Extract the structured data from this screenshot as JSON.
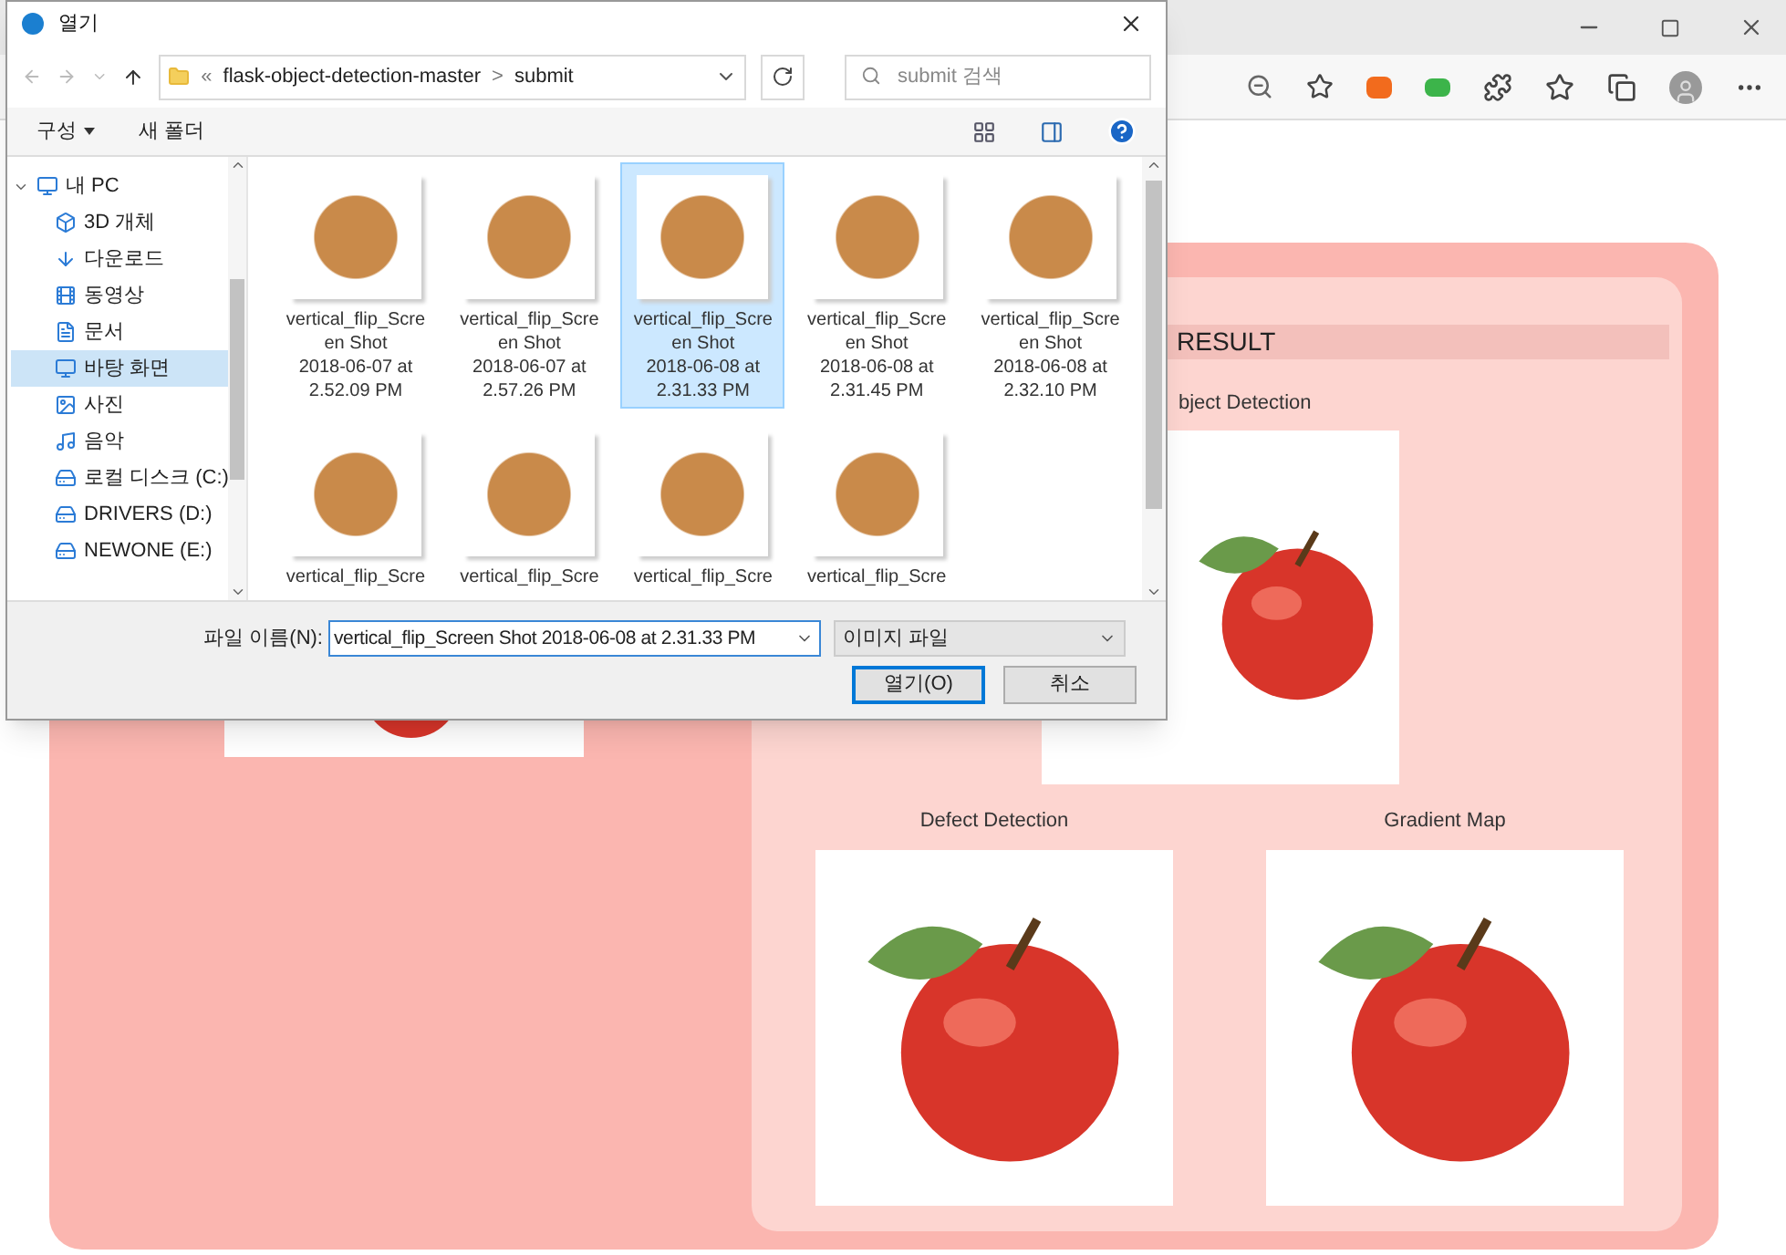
{
  "page": {
    "result_title": "RESULT",
    "panels": [
      {
        "title": "bject Detection"
      },
      {
        "title": "Defect Detection"
      },
      {
        "title": "Gradient Map"
      }
    ]
  },
  "dialog": {
    "title": "열기",
    "address": {
      "prefix": "«",
      "folder": "flask-object-detection-master",
      "separator": ">",
      "current": "submit"
    },
    "search": {
      "placeholder": "submit 검색"
    },
    "toolbar": [
      {
        "label": "구성",
        "kind": "menu"
      },
      {
        "label": "새 폴더",
        "kind": "button"
      }
    ],
    "sidebar": [
      {
        "label": "내 PC",
        "kind": "pc",
        "expanded": true,
        "selected": false,
        "children": [
          {
            "label": "3D 개체",
            "kind": "cube",
            "selected": false
          },
          {
            "label": "다운로드",
            "kind": "download",
            "selected": false
          },
          {
            "label": "동영상",
            "kind": "video",
            "selected": false
          },
          {
            "label": "문서",
            "kind": "document",
            "selected": false
          },
          {
            "label": "바탕 화면",
            "kind": "desktop",
            "selected": true
          },
          {
            "label": "사진",
            "kind": "picture",
            "selected": false
          },
          {
            "label": "음악",
            "kind": "music",
            "selected": false
          },
          {
            "label": "로컬 디스크 (C:)",
            "kind": "disk",
            "selected": false
          },
          {
            "label": "DRIVERS (D:)",
            "kind": "drive",
            "selected": false
          },
          {
            "label": "NEWONE (E:)",
            "kind": "drive",
            "selected": false
          }
        ]
      }
    ],
    "files": [
      {
        "lines": [
          "vertical_flip_Scre",
          "en Shot",
          "2018-06-07 at",
          "2.52.09 PM"
        ],
        "selected": false
      },
      {
        "lines": [
          "vertical_flip_Scre",
          "en Shot",
          "2018-06-07 at",
          "2.57.26 PM"
        ],
        "selected": false
      },
      {
        "lines": [
          "vertical_flip_Scre",
          "en Shot",
          "2018-06-08 at",
          "2.31.33 PM"
        ],
        "selected": true
      },
      {
        "lines": [
          "vertical_flip_Scre",
          "en Shot",
          "2018-06-08 at",
          "2.31.45 PM"
        ],
        "selected": false
      },
      {
        "lines": [
          "vertical_flip_Scre",
          "en Shot",
          "2018-06-08 at",
          "2.32.10 PM"
        ],
        "selected": false
      },
      {
        "lines": [
          "vertical_flip_Scre"
        ],
        "selected": false
      },
      {
        "lines": [
          "vertical_flip_Scre"
        ],
        "selected": false
      },
      {
        "lines": [
          "vertical_flip_Scre"
        ],
        "selected": false
      },
      {
        "lines": [
          "vertical_flip_Scre"
        ],
        "selected": false
      }
    ],
    "filename": {
      "label": "파일 이름(N):",
      "value": "vertical_flip_Screen Shot 2018-06-08 at 2.31.33 PM"
    },
    "filetype": {
      "value": "이미지 파일"
    },
    "buttons": [
      {
        "label": "열기(O)",
        "kind": "primary"
      },
      {
        "label": "취소",
        "kind": "secondary"
      }
    ]
  }
}
